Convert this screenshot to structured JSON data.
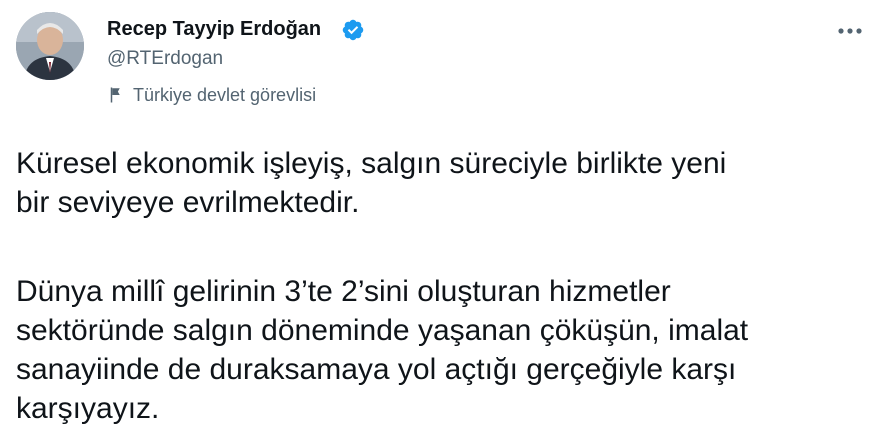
{
  "author": {
    "name": "Recep Tayyip Erdoğan",
    "handle": "@RTErdogan",
    "label": "Türkiye devlet görevlisi",
    "verified": true,
    "avatar_icon": "profile-photo",
    "label_icon": "flag-icon",
    "verified_icon": "verified-badge-icon"
  },
  "menu": {
    "icon": "more-options-icon"
  },
  "tweet": {
    "paragraphs": [
      "Küresel ekonomik işleyiş, salgın süreciyle birlikte yeni\nbir seviyeye evrilmektedir.",
      "Dünya millî gelirinin 3’te 2’sini oluşturan hizmetler\nsektöründe salgın döneminde yaşanan çöküşün, imalat\nsanayiinde de duraksamaya yol açtığı gerçeğiyle karşı\nkarşıyayız."
    ]
  },
  "colors": {
    "text": "#0f1419",
    "secondary": "#536471",
    "verified": "#1d9bf0"
  }
}
